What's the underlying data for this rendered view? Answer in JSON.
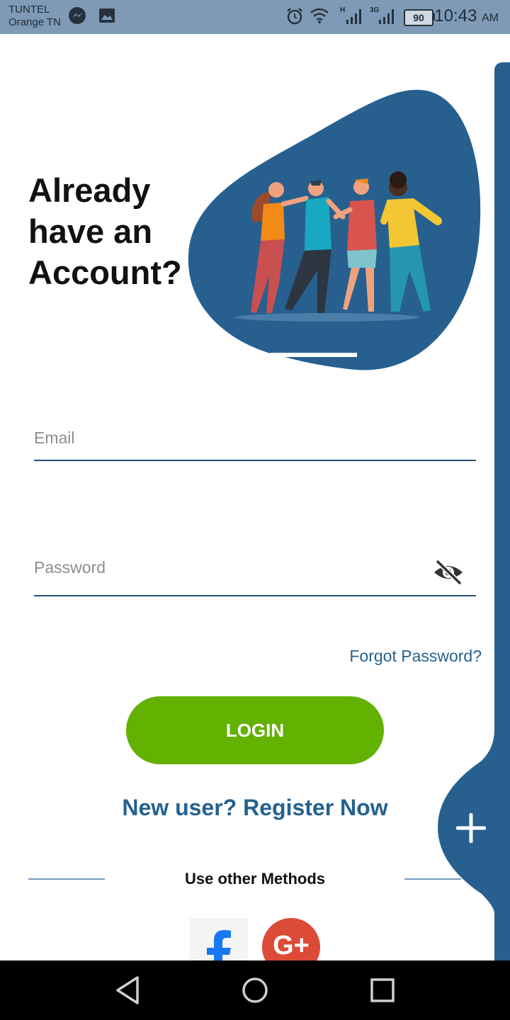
{
  "status_bar": {
    "carrier_line1": "TUNTEL",
    "carrier_line2": "Orange TN",
    "signal_h": "H",
    "signal_3g": "3G",
    "battery": "90",
    "time": "10:43",
    "ampm": "AM",
    "icons": [
      "messenger-icon",
      "gallery-icon",
      "alarm-icon",
      "wifi-icon",
      "signal-icon",
      "signal-icon",
      "battery-icon"
    ]
  },
  "heading": {
    "line1": "Already",
    "line2": "have an",
    "line3": "Account?"
  },
  "form": {
    "email_placeholder": "Email",
    "email_value": "",
    "password_placeholder": "Password",
    "password_value": ""
  },
  "forgot_password": "Forgot Password?",
  "login_label": "LOGIN",
  "register_label": "New user? Register Now",
  "other_methods_label": "Use other Methods",
  "social": {
    "facebook_icon": "facebook-icon",
    "google_icon": "google-plus-icon",
    "google_text": "G+"
  },
  "colors": {
    "primary_blue": "#27608e",
    "login_green": "#63b100",
    "link_blue": "#24628f",
    "google_red": "#dc4a38",
    "facebook_blue": "#1877f2",
    "status_bar_bg": "#7f9ab6"
  }
}
